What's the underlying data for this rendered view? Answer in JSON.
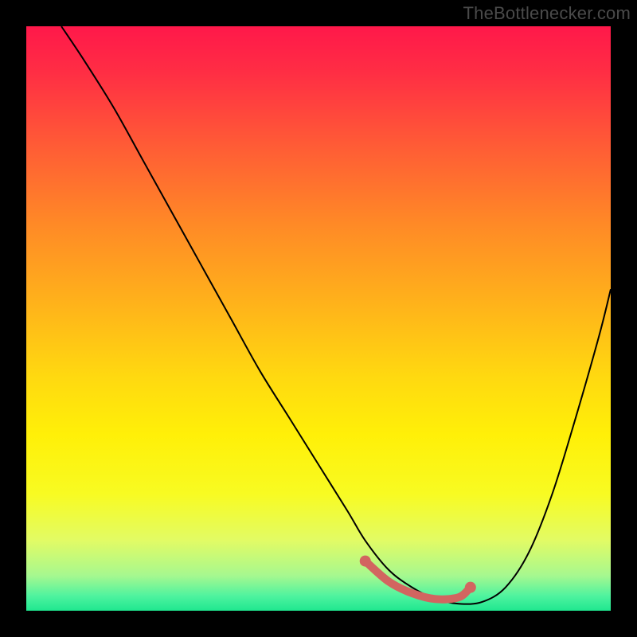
{
  "watermark": "TheBottlenecker.com",
  "chart_data": {
    "type": "line",
    "title": "",
    "xlabel": "",
    "ylabel": "",
    "xlim": [
      0,
      100
    ],
    "ylim": [
      0,
      100
    ],
    "gradient_stops": [
      {
        "pct": 0,
        "color": "#ff184a"
      },
      {
        "pct": 50,
        "color": "#ffd400"
      },
      {
        "pct": 100,
        "color": "#1fe78f"
      }
    ],
    "series": [
      {
        "name": "bottleneck-curve",
        "x": [
          6,
          10,
          15,
          20,
          25,
          30,
          35,
          40,
          45,
          50,
          55,
          58,
          62,
          66,
          70,
          74,
          78,
          82,
          86,
          90,
          94,
          98,
          100
        ],
        "y": [
          100,
          94,
          86,
          77,
          68,
          59,
          50,
          41,
          33,
          25,
          17,
          12,
          7,
          4,
          2,
          1.2,
          1.5,
          4,
          10,
          20,
          33,
          47,
          55
        ]
      }
    ],
    "markers": {
      "name": "optimal-range",
      "x": [
        58,
        62,
        66,
        70,
        74,
        76
      ],
      "y": [
        8.5,
        5,
        3,
        2,
        2.3,
        4
      ],
      "color": "#d26560"
    }
  }
}
